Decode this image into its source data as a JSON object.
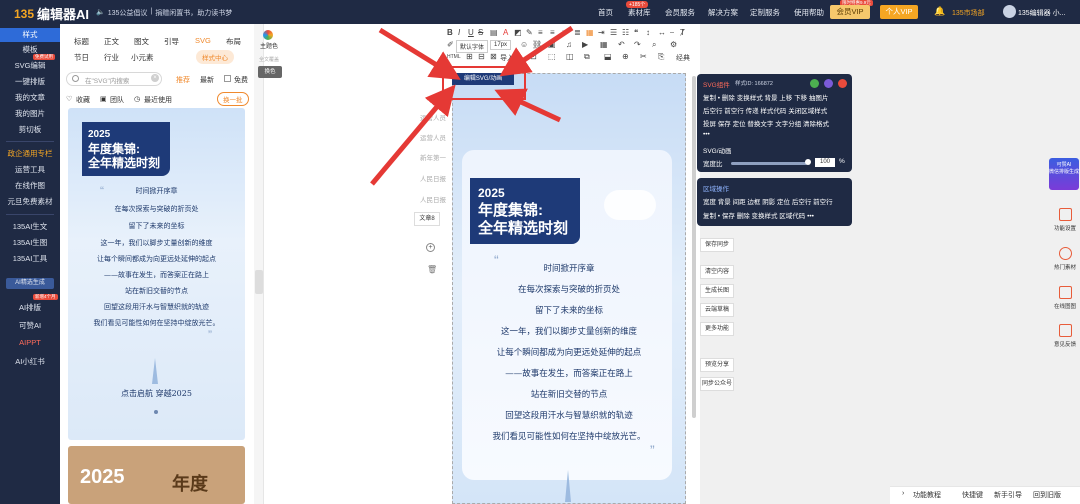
{
  "topbar": {
    "logo_mark": "135",
    "logo_text": "编辑器AI",
    "notice_icon": "speaker-icon",
    "notice_1": "135公益倡议",
    "notice_2": "捐赠闲置书，助力读书梦",
    "nav": [
      "首页",
      "素材库",
      "会员服务",
      "解决方案",
      "定制服务",
      "使用帮助"
    ],
    "nav_badge": "+185个",
    "vip_badge": "限时特惠9.9元",
    "vip_label": "会员VIP",
    "personal_vip": "个人VIP",
    "bell_icon": "bell-icon",
    "user_org": "135市场部",
    "user_name": "135编辑器 小..."
  },
  "sidebar": {
    "items": [
      {
        "label": "样式",
        "active": true
      },
      {
        "label": "模板"
      },
      {
        "label": "SVG编辑"
      },
      {
        "label": "一键排版"
      },
      {
        "label": "我的文章"
      },
      {
        "label": "我的图片"
      },
      {
        "label": "剪切板"
      }
    ],
    "badges": {
      "svg": "免费试用",
      "aippt": "新增4个月"
    },
    "group_title": "政企通用专栏",
    "group_items": [
      "运营工具",
      "在线作图",
      "元旦免费素材"
    ],
    "ai_items": [
      "135AI生文",
      "135AI生图",
      "135AI工具"
    ],
    "highlight": "AI精选生成",
    "more_items": [
      "AI排版",
      "可赞AI",
      "AIPPT",
      "AI小红书"
    ]
  },
  "panel": {
    "tabs_row1": [
      "标题",
      "正文",
      "图文",
      "引导",
      "SVG",
      "布局"
    ],
    "tabs_row2": [
      "节日",
      "行业",
      "小元素"
    ],
    "active_tab": "SVG",
    "style_center": "样式中心",
    "search_placeholder": "在\"SVG\"内搜索",
    "filters": [
      "推荐",
      "最新",
      "免费"
    ],
    "tools": [
      "收藏",
      "团队",
      "最近使用"
    ],
    "swap": "换一批",
    "card1": {
      "year": "2025",
      "title": "年度集锦:",
      "subtitle": "全年精选时刻",
      "lines": [
        "时间掀开序章",
        "在每次探索与突破的折页处",
        "留下了未来的坐标",
        "这一年，我们以脚步丈量创新的维度",
        "让每个瞬间都成为向更远处延伸的起点",
        "——故事在发生，而答案正在路上",
        "站在新旧交替的节点",
        "回望这段用汗水与智慧织就的轨迹",
        "我们看见可能性如何在坚持中绽放光芒。"
      ],
      "footer": "点击启航  穿越2025"
    },
    "card2": {
      "year": "2025",
      "title": "年度"
    }
  },
  "editor": {
    "theme": "主题色",
    "theme_sub": "全文覆盖",
    "theme_btn": "换色",
    "toolbar_font": "默认字体",
    "toolbar_size": "17px",
    "edit_svg": "编辑SVG/动画",
    "ghost_items": [
      "运营人员",
      "运营人员",
      "新年第一",
      "人民日报",
      "人民日报"
    ],
    "side_btn": "文章8",
    "html_label": "HTML",
    "import_label": "导入",
    "classic_label": "经典"
  },
  "canvas": {
    "year": "2025",
    "title": "年度集锦:",
    "subtitle": "全年精选时刻",
    "lines": [
      "时间掀开序章",
      "在每次探索与突破的折页处",
      "留下了未来的坐标",
      "这一年，我们以脚步丈量创新的维度",
      "让每个瞬间都成为向更远处延伸的起点",
      "——故事在发生，而答案正在路上",
      "站在新旧交替的节点",
      "回望这段用汗水与智慧织就的轨迹",
      "我们看见可能性如何在坚持中绽放光芒。"
    ]
  },
  "popup1": {
    "title": "SVG组件",
    "id_label": "样式ID: 166872",
    "row1": "复制 • 删除 变换样式 背景 上移 下移 抽图片",
    "row2": "后空行 前空行 传递 样式代码 关闭区域样式",
    "row3": "投屏 保存 定位 替换文字 文字分组 清除格式",
    "row4": "•••",
    "svg_label": "SVG/动画",
    "width_label": "宽度比",
    "width_value": "100",
    "percent": "%"
  },
  "popup2": {
    "title": "区域操作",
    "row1": "宽度 背景 间距 边框 阴影 定位 后空行 前空行",
    "row2": "复制 • 保存 删除 变换样式 区域代码 •••"
  },
  "right_actions": [
    "保存同步",
    "清空内容",
    "生成长图",
    "云端草稿",
    "更多功能",
    "预览分享",
    "同步公众号"
  ],
  "promo": {
    "line1": "可赞AI",
    "line2": "微信排版生成"
  },
  "right_side": [
    "功能设置",
    "热门素材",
    "在线图图",
    "意见反馈"
  ],
  "footer": [
    "功能教程",
    "快捷键",
    "新手引导",
    "回到旧版"
  ],
  "colors": {
    "accent": "#f08a2e",
    "nav": "#1f2a44",
    "title": "#1e3a78",
    "arrow": "#e53935"
  }
}
